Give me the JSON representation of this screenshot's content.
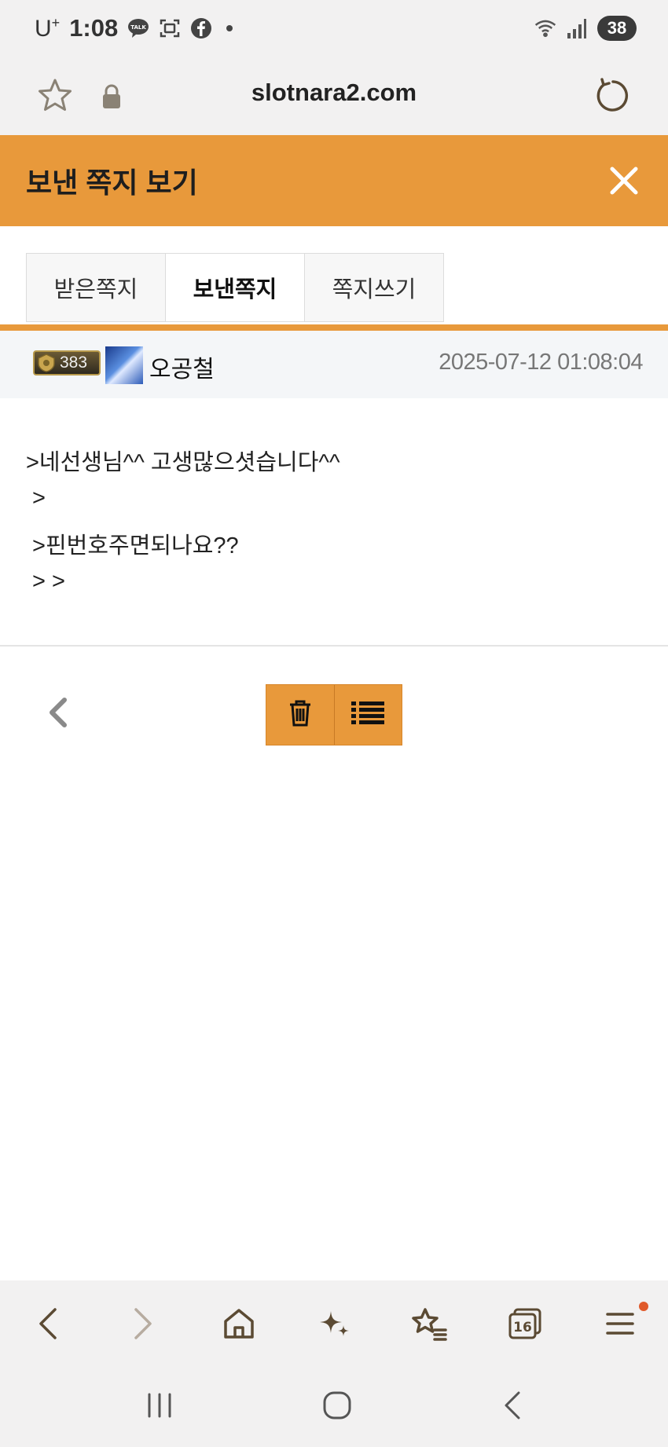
{
  "status_bar": {
    "carrier": "U",
    "carrier_sup": "+",
    "time": "1:08",
    "battery": "38",
    "icons": [
      "talk-icon",
      "screenshot-icon",
      "facebook-icon",
      "dot-icon",
      "wifi-icon",
      "signal-icon"
    ]
  },
  "browser": {
    "url": "slotnara2.com",
    "icons": [
      "star-icon",
      "lock-icon",
      "reload-icon"
    ]
  },
  "header": {
    "title": "보낸 쪽지 보기"
  },
  "tabs": [
    {
      "label": "받은쪽지",
      "active": false
    },
    {
      "label": "보낸쪽지",
      "active": true
    },
    {
      "label": "쪽지쓰기",
      "active": false
    }
  ],
  "message": {
    "level": "383",
    "sender": "오공철",
    "date": "2025-07-12 01:08:04",
    "lines": [
      ">네선생님^^ 고생많으셧습니다^^",
      " >",
      " >핀번호주면되나요??",
      " > >"
    ]
  },
  "actions": {
    "icons": [
      "chevron-left-icon",
      "trash-icon",
      "list-icon"
    ]
  },
  "bottom_nav": {
    "tab_count": "16",
    "icons": [
      "back-icon",
      "forward-icon",
      "home-icon",
      "sparkle-icon",
      "bookmarks-icon",
      "tabs-icon",
      "menu-icon"
    ]
  },
  "system_nav": {
    "icons": [
      "recents-icon",
      "home-circle-icon",
      "system-back-icon"
    ]
  },
  "colors": {
    "accent": "#e8993b",
    "chrome_bg": "#f2f1f1",
    "meta_bg": "#f4f6f8"
  }
}
